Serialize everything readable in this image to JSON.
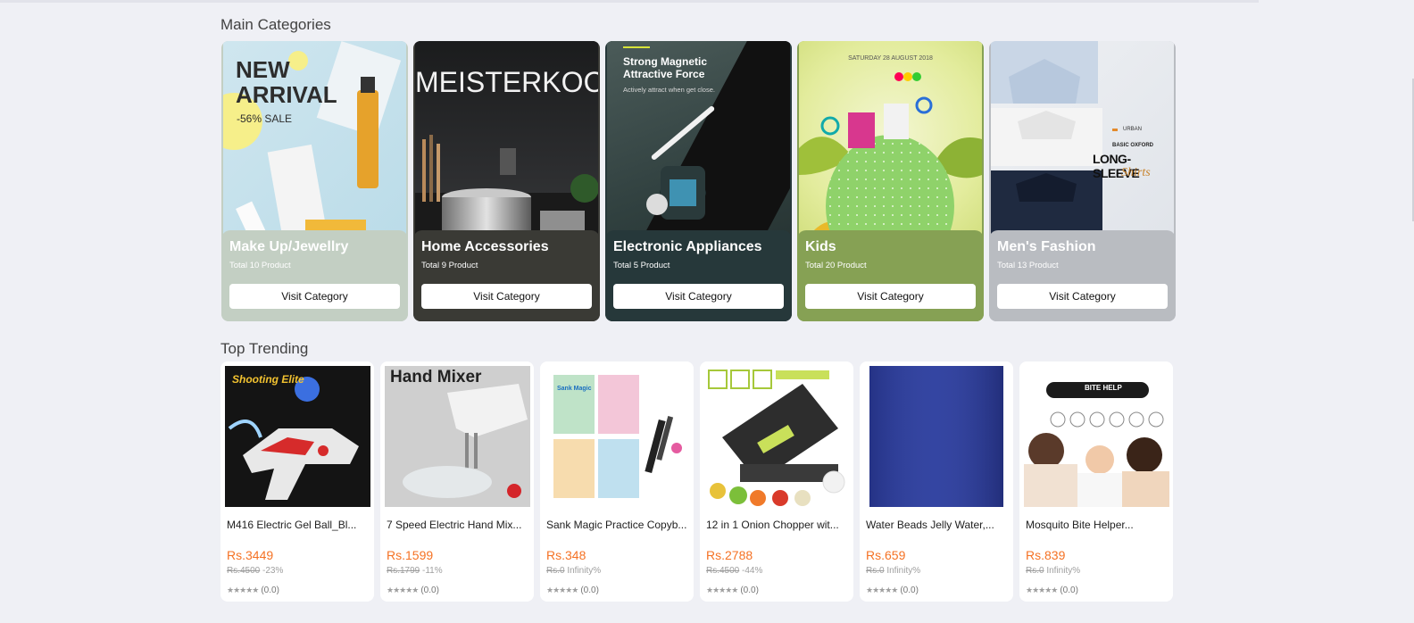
{
  "sections": {
    "main_categories": "Main Categories",
    "top_trending": "Top Trending"
  },
  "categories": [
    {
      "name": "Make Up/Jewellry",
      "count": "Total 10 Product",
      "button": "Visit Category",
      "color": "#c3cfc3",
      "art": {
        "line1": "NEW",
        "line2": "ARRIVAL",
        "line3": "-56% SALE"
      }
    },
    {
      "name": "Home Accessories",
      "count": "Total 9 Product",
      "button": "Visit Category",
      "color": "#3a3a35",
      "art": {
        "line1": "MEISTERKOCH"
      }
    },
    {
      "name": "Electronic Appliances",
      "count": "Total 5 Product",
      "button": "Visit Category",
      "color": "#26383a",
      "art": {
        "line1": "Strong Magnetic",
        "line2": "Attractive Force",
        "line3": "Actively attract when get close."
      }
    },
    {
      "name": "Kids",
      "count": "Total 20 Product",
      "button": "Visit Category",
      "color": "#86a154",
      "art": {
        "line1": "SATURDAY 28 AUGUST 2018"
      }
    },
    {
      "name": "Men's Fashion",
      "count": "Total 13 Product",
      "button": "Visit Category",
      "color": "#b9bcc1",
      "art": {
        "line1": "URBAN",
        "line2": "BASIC OXFORD",
        "line3": "LONG-SLEEVE",
        "line4": "Shirts"
      }
    }
  ],
  "products": [
    {
      "name": "M416 Electric Gel Ball_Bl...",
      "price": "Rs.3449",
      "old": "Rs.4500",
      "discount": "-23%",
      "rating": "(0.0)",
      "art": "Shooting Elite"
    },
    {
      "name": "7 Speed Electric Hand Mix...",
      "price": "Rs.1599",
      "old": "Rs.1799",
      "discount": "-11%",
      "rating": "(0.0)",
      "art": "Hand Mixer"
    },
    {
      "name": "Sank Magic Practice Copyb...",
      "price": "Rs.348",
      "old": "Rs.0",
      "discount": "Infinity%",
      "rating": "(0.0)",
      "art": "Sank Magic"
    },
    {
      "name": "12 in 1 Onion Chopper wit...",
      "price": "Rs.2788",
      "old": "Rs.4500",
      "discount": "-44%",
      "rating": "(0.0)",
      "art": ""
    },
    {
      "name": "Water Beads Jelly Water,...",
      "price": "Rs.659",
      "old": "Rs.0",
      "discount": "Infinity%",
      "rating": "(0.0)",
      "art": ""
    },
    {
      "name": "Mosquito Bite Helper...",
      "price": "Rs.839",
      "old": "Rs.0",
      "discount": "Infinity%",
      "rating": "(0.0)",
      "art": "BITE HELP"
    }
  ],
  "stars": "★★★★★",
  "colors": {
    "price": "#f57224",
    "background": "#eff0f5"
  }
}
